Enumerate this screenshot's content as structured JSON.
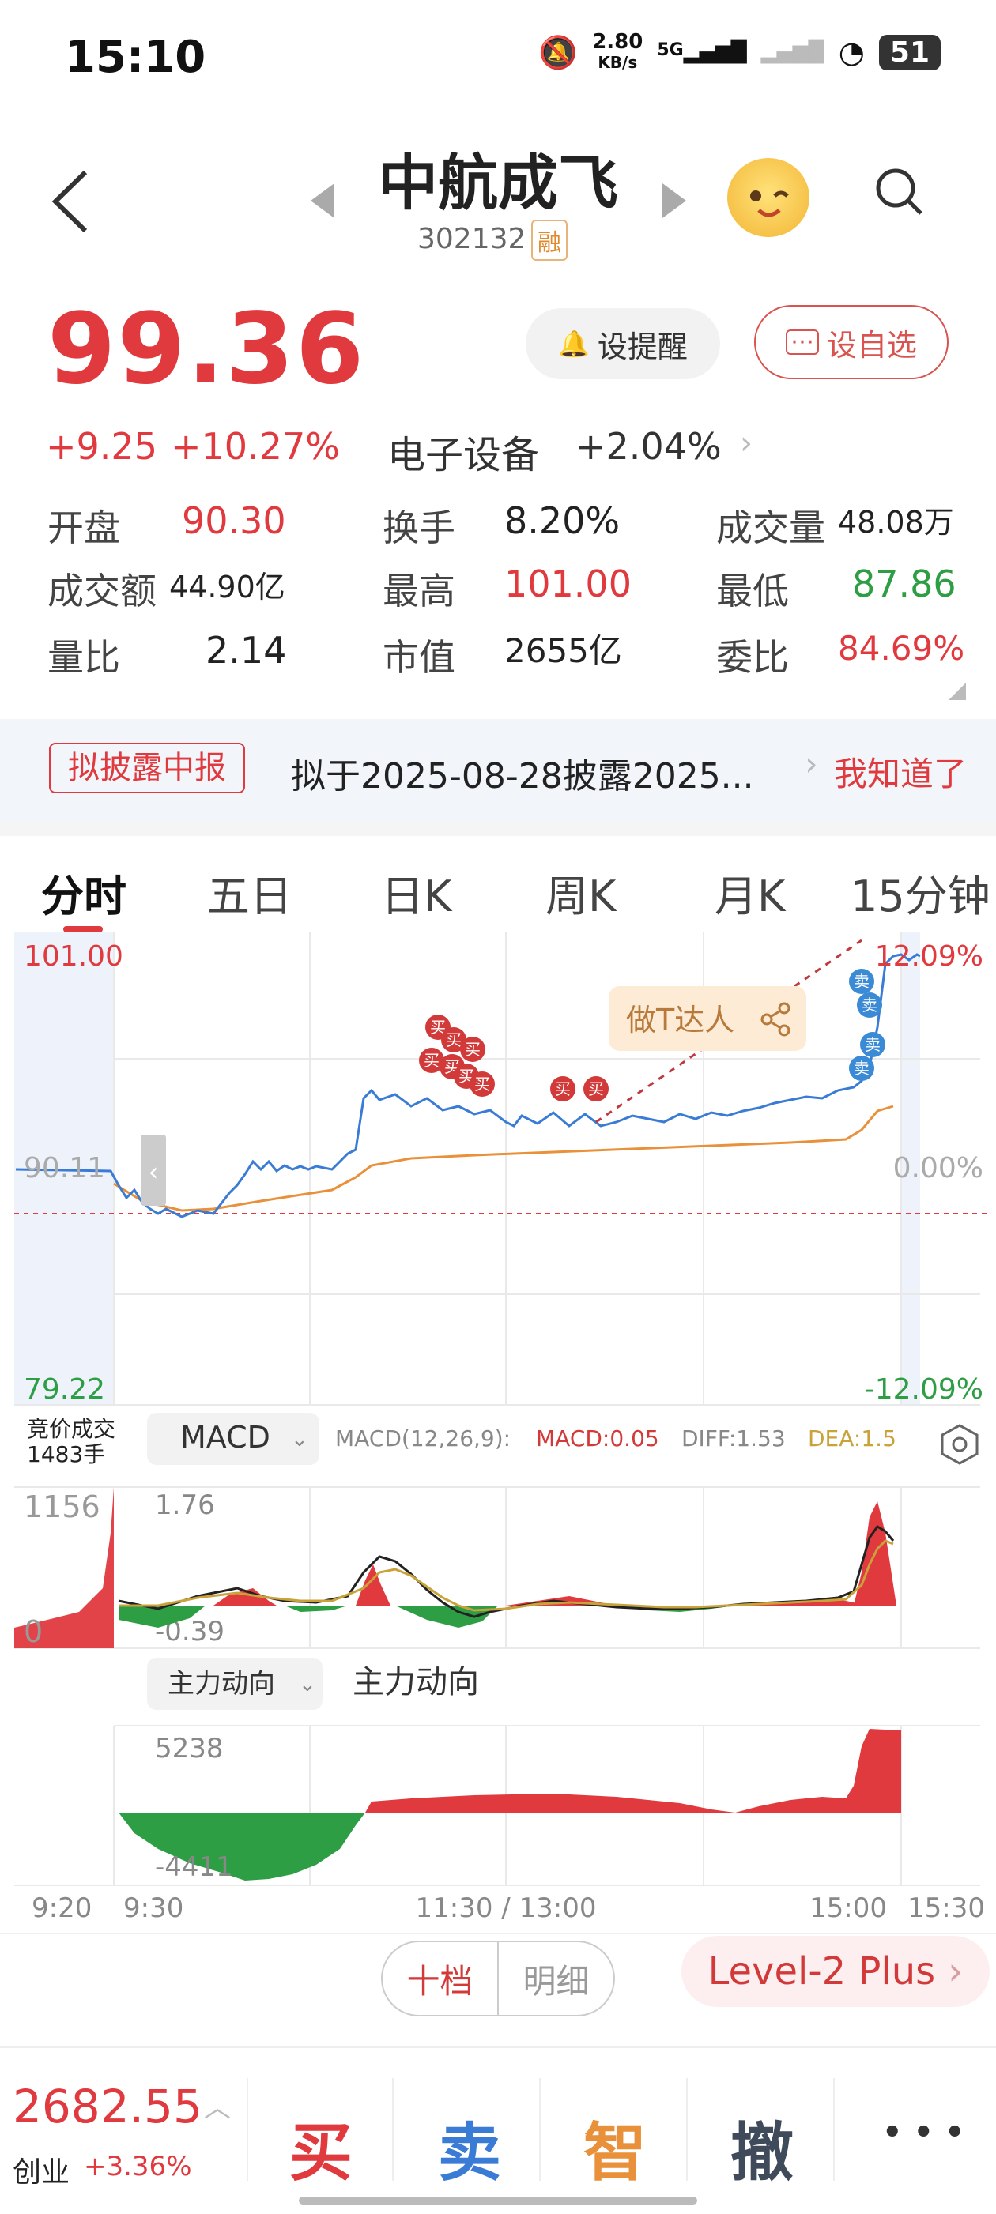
{
  "status": {
    "time": "15:10",
    "net_speed": "2.80",
    "net_unit": "KB/s",
    "net_type": "5G",
    "battery": "51"
  },
  "header": {
    "title": "中航成飞",
    "code": "302132",
    "tag": "融"
  },
  "quote": {
    "price": "99.36",
    "change": "+9.25",
    "change_pct": "+10.27%",
    "remind_label": "设提醒",
    "fav_label": "设自选",
    "sector": "电子设备",
    "sector_pct": "+2.04%"
  },
  "stats": [
    {
      "label": "开盘",
      "value": "90.30"
    },
    {
      "label": "换手",
      "value": "8.20%"
    },
    {
      "label": "成交量",
      "value": "48.08万"
    },
    {
      "label": "成交额",
      "value": "44.90亿"
    },
    {
      "label": "最高",
      "value": "101.00"
    },
    {
      "label": "最低",
      "value": "87.86"
    },
    {
      "label": "量比",
      "value": "2.14"
    },
    {
      "label": "市值",
      "value": "2655亿"
    },
    {
      "label": "委比",
      "value": "84.69%"
    }
  ],
  "notice": {
    "tag": "拟披露中报",
    "text": "拟于2025-08-28披露2025...",
    "link": "我知道了"
  },
  "tabs": [
    "分时",
    "五日",
    "日K",
    "周K",
    "月K",
    "15分钟"
  ],
  "chart": {
    "price_high": "101.00",
    "price_mid": "90.11",
    "price_low": "79.22",
    "pct_high": "12.09%",
    "pct_mid": "0.00%",
    "pct_low": "-12.09%",
    "badge": "做T达人",
    "buy_mark": "买",
    "sell_mark": "卖",
    "auction_label": "竞价成交",
    "auction_value": "1483手",
    "indicator": "MACD",
    "macd_params": "MACD(12,26,9):",
    "macd_val": "MACD:0.05",
    "diff_val": "DIFF:1.53",
    "dea_val": "DEA:1.5",
    "vol_max": "1156",
    "vol_zero": "0",
    "macd_top": "1.76",
    "macd_bottom": "-0.39",
    "flow_selector": "主力动向",
    "flow_title": "主力动向",
    "flow_top": "5238",
    "flow_bottom": "-4411",
    "time_labels": [
      "9:20",
      "9:30",
      "11:30 / 13:00",
      "15:00",
      "15:30"
    ]
  },
  "bottom": {
    "seg_left": "十档",
    "seg_right": "明细",
    "level2": "Level-2 Plus",
    "index_value": "2682.55",
    "index_name": "创业",
    "index_chg": "+3.36%",
    "buy": "买",
    "sell": "卖",
    "smart": "智",
    "cancel": "撤",
    "more": "• • •"
  },
  "colors": {
    "up": "#e0393e",
    "down": "#2e9e45",
    "price_line": "#3a7bd5",
    "avg_line": "#e8913a"
  }
}
